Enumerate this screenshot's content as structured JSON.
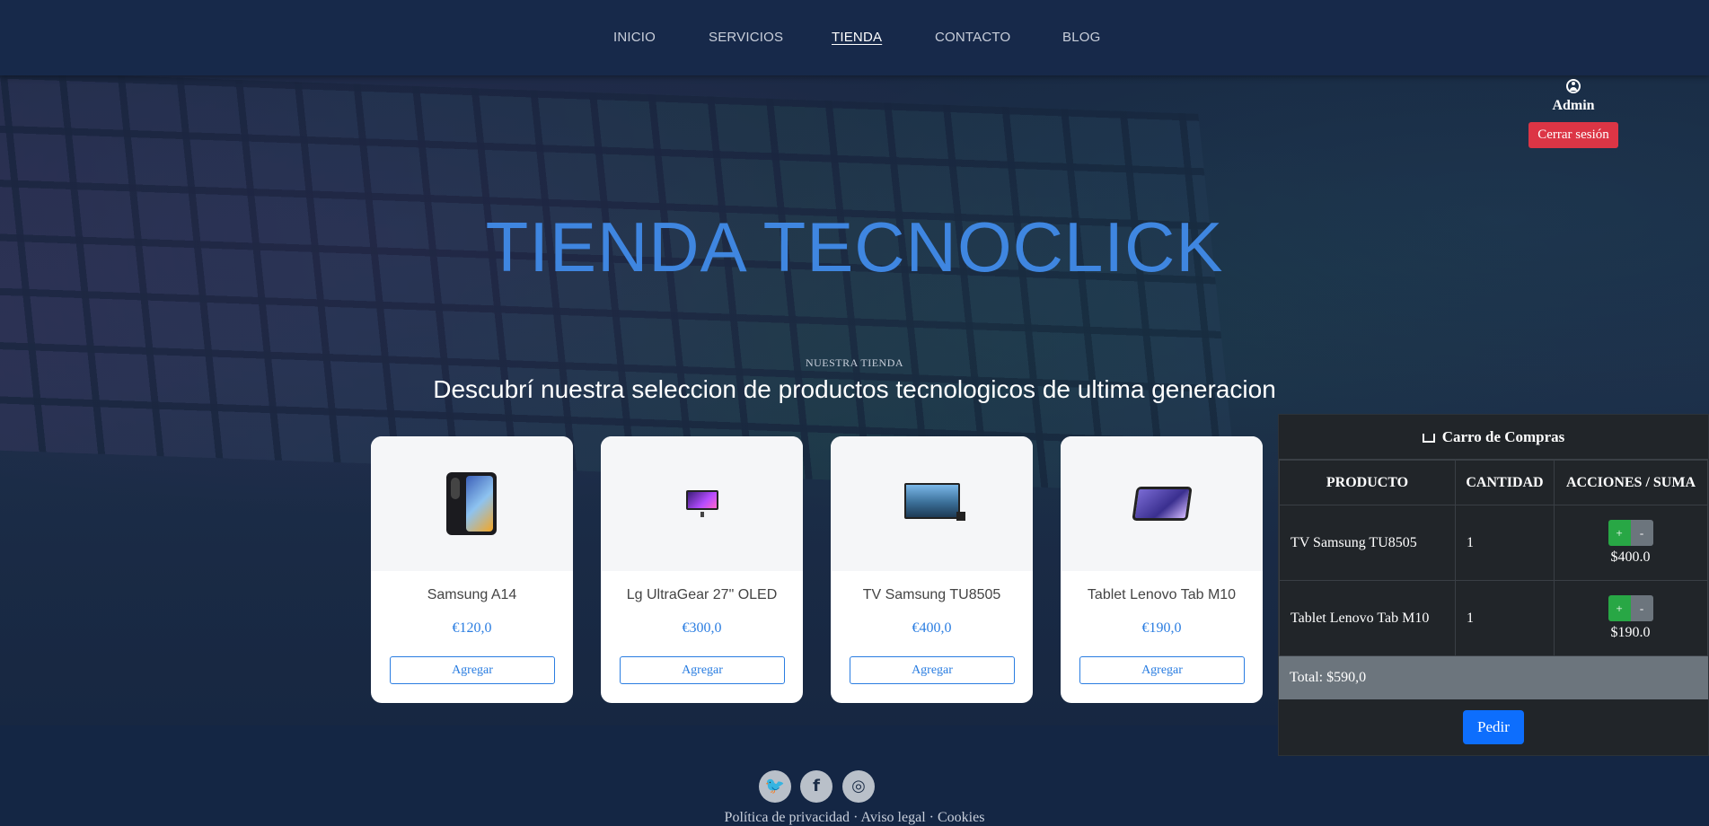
{
  "nav": {
    "items": [
      "INICIO",
      "SERVICIOS",
      "TIENDA",
      "CONTACTO",
      "BLOG"
    ],
    "active": "TIENDA"
  },
  "admin": {
    "name": "Admin",
    "logout": "Cerrar sesión"
  },
  "hero": {
    "title": "TIENDA TECNOCLICK",
    "eyebrow": "NUESTRA TIENDA",
    "subtitle": "Descubrí nuestra seleccion de productos tecnologicos de ultima generacion"
  },
  "products": [
    {
      "name": "Samsung A14",
      "price": "€120,0",
      "button": "Agregar",
      "icon": "phone-icon"
    },
    {
      "name": "Lg UltraGear 27\" OLED",
      "price": "€300,0",
      "button": "Agregar",
      "icon": "monitor-icon"
    },
    {
      "name": "TV Samsung TU8505",
      "price": "€400,0",
      "button": "Agregar",
      "icon": "tv-icon"
    },
    {
      "name": "Tablet Lenovo Tab M10",
      "price": "€190,0",
      "button": "Agregar",
      "icon": "tablet-icon"
    }
  ],
  "cart": {
    "title": "Carro de Compras",
    "headers": [
      "PRODUCTO",
      "CANTIDAD",
      "ACCIONES / SUMA"
    ],
    "rows": [
      {
        "product": "TV Samsung TU8505",
        "qty": "1",
        "plus": "+",
        "minus": "-",
        "sum": "$400.0"
      },
      {
        "product": "Tablet Lenovo Tab M10",
        "qty": "1",
        "plus": "+",
        "minus": "-",
        "sum": "$190.0"
      }
    ],
    "total": "Total: $590,0",
    "order_button": "Pedir"
  },
  "footer": {
    "social": [
      "twitter-icon",
      "facebook-icon",
      "instagram-icon"
    ],
    "privacy": "Política de privacidad",
    "sep": " · ",
    "legal": "Aviso legal",
    "cookies": "Cookies"
  },
  "colors": {
    "nav_bg": "#17294a",
    "title": "#3f86e0",
    "logout": "#dc3545",
    "cart_bg": "#212529",
    "plus": "#28a745",
    "minus": "#6c757d",
    "order": "#0d6efd"
  }
}
